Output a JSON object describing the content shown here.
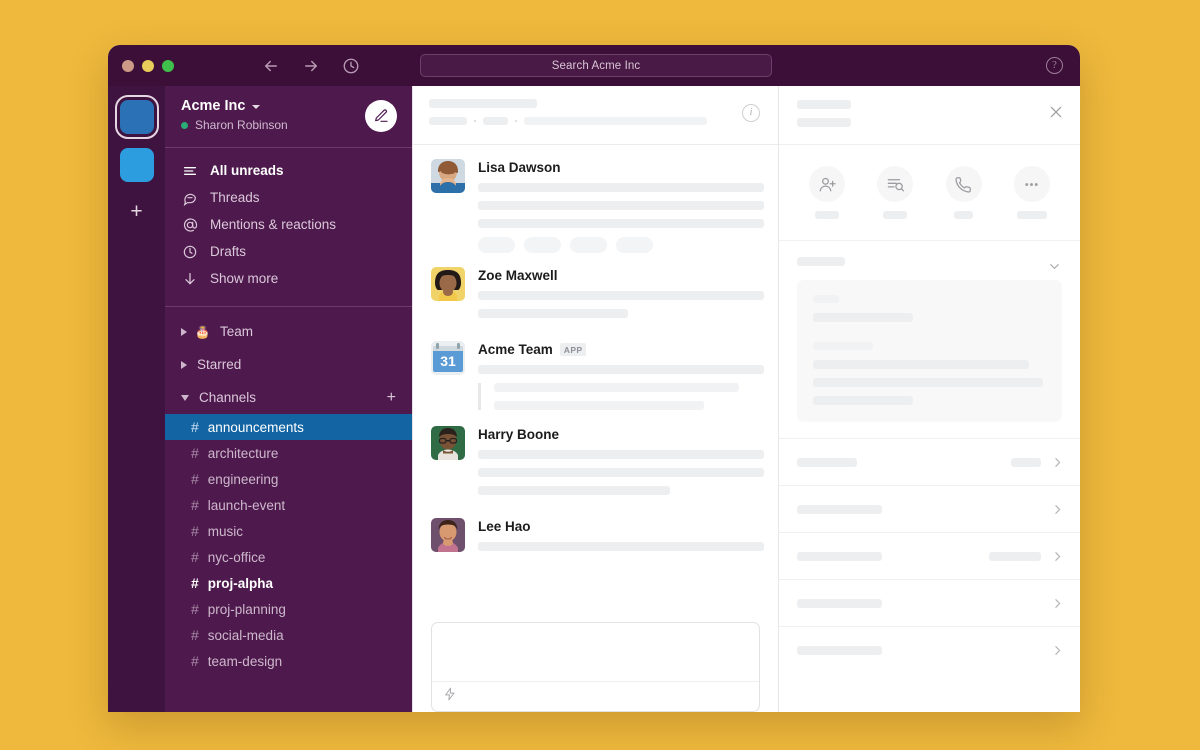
{
  "window": {
    "traffic_lights": [
      "close",
      "minimize",
      "maximize"
    ],
    "search_placeholder": "Search Acme Inc",
    "help_label": "?",
    "info_label": "i"
  },
  "rail": {
    "workspaces": [
      {
        "name": "workspace-tile-active",
        "active": true
      },
      {
        "name": "workspace-tile-2",
        "active": false
      }
    ],
    "add_label": "+"
  },
  "sidebar": {
    "workspace_name": "Acme Inc",
    "user_name": "Sharon Robinson",
    "nav": [
      {
        "label": "All unreads",
        "icon": "unreads-icon",
        "bold": true
      },
      {
        "label": "Threads",
        "icon": "threads-icon",
        "bold": false
      },
      {
        "label": "Mentions & reactions",
        "icon": "mentions-icon",
        "bold": false
      },
      {
        "label": "Drafts",
        "icon": "drafts-icon",
        "bold": false
      },
      {
        "label": "Show more",
        "icon": "show-more-icon",
        "bold": false
      }
    ],
    "groups": [
      {
        "label": "Team",
        "emoji": "🎂",
        "open": false
      },
      {
        "label": "Starred",
        "emoji": "",
        "open": false
      },
      {
        "label": "Channels",
        "emoji": "",
        "open": true,
        "add_label": "+"
      }
    ],
    "channels": [
      {
        "name": "announcements",
        "state": "selected"
      },
      {
        "name": "architecture",
        "state": "read"
      },
      {
        "name": "engineering",
        "state": "read"
      },
      {
        "name": "launch-event",
        "state": "read"
      },
      {
        "name": "music",
        "state": "read"
      },
      {
        "name": "nyc-office",
        "state": "read"
      },
      {
        "name": "proj-alpha",
        "state": "unread"
      },
      {
        "name": "proj-planning",
        "state": "read"
      },
      {
        "name": "social-media",
        "state": "read"
      },
      {
        "name": "team-design",
        "state": "read"
      }
    ]
  },
  "messages": {
    "items": [
      {
        "author": "Lisa Dawson",
        "avatar": "avatar-lisa",
        "badge": "",
        "lines": [
          286,
          286,
          286
        ],
        "chips": 4,
        "quote_lines": []
      },
      {
        "author": "Zoe Maxwell",
        "avatar": "avatar-zoe",
        "badge": "",
        "lines": [
          286,
          150
        ],
        "chips": 0,
        "quote_lines": []
      },
      {
        "author": "Acme Team",
        "avatar": "avatar-acme-calendar",
        "badge": "APP",
        "lines": [
          286
        ],
        "chips": 0,
        "quote_lines": [
          245,
          210
        ]
      },
      {
        "author": "Harry Boone",
        "avatar": "avatar-harry",
        "badge": "",
        "lines": [
          286,
          286,
          192
        ],
        "chips": 0,
        "quote_lines": []
      },
      {
        "author": "Lee Hao",
        "avatar": "avatar-lee",
        "badge": "",
        "lines": [
          286
        ],
        "chips": 0,
        "quote_lines": []
      }
    ]
  },
  "right_panel": {
    "actions": [
      {
        "icon": "add-person-icon"
      },
      {
        "icon": "find-list-icon"
      },
      {
        "icon": "call-icon"
      },
      {
        "icon": "more-options-icon"
      }
    ],
    "rows": [
      {
        "has_value": true
      },
      {
        "has_value": false
      },
      {
        "has_value": true
      },
      {
        "has_value": false
      },
      {
        "has_value": false
      }
    ]
  }
}
